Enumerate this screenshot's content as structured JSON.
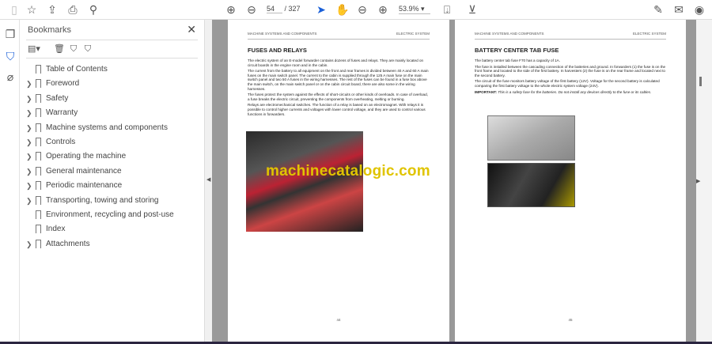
{
  "toolbar": {
    "page_current": "54",
    "page_total": "/ 327",
    "zoom": "53.9%"
  },
  "bookmarks": {
    "title": "Bookmarks",
    "items": [
      {
        "label": "Table of Contents",
        "expandable": false
      },
      {
        "label": "Foreword",
        "expandable": true
      },
      {
        "label": "Safety",
        "expandable": true
      },
      {
        "label": "Warranty",
        "expandable": true
      },
      {
        "label": "Machine systems and components",
        "expandable": true
      },
      {
        "label": "Controls",
        "expandable": true
      },
      {
        "label": "Operating the machine",
        "expandable": true
      },
      {
        "label": "General maintenance",
        "expandable": true
      },
      {
        "label": "Periodic maintenance",
        "expandable": true
      },
      {
        "label": "Transporting, towing and storing",
        "expandable": true
      },
      {
        "label": "Environment, recycling and post-use",
        "expandable": false
      },
      {
        "label": "Index",
        "expandable": false
      },
      {
        "label": "Attachments",
        "expandable": true
      }
    ]
  },
  "page1": {
    "header_left": "MACHINE SYSTEMS AND COMPONENTS",
    "header_right": "ELECTRIC SYSTEM",
    "title": "FUSES AND RELAYS",
    "paragraphs": [
      "The electric system of an E-model forwarder contains dozens of fuses and relays. They are mainly located on circuit boards in the engine room and in the cabin.",
      "The current from the battery to all equipment on the front and rear frames is divided between 40 A and 60 A main fuses on the main switch panel. The current to the cabin is supplied through the 125 A main fuse on the main switch panel and two 50 A fuses in the wiring harnesses. The rest of the fuses can be found in a fuse box above the main switch, on the main switch panel or on the cabin circuit board, there are also some in the wiring harnesses.",
      "The fuses protect the system against the effects of short-circuits or other kinds of overloads. In case of overload, a fuse breaks the electric circuit, preventing the components from overheating, melting or burning.",
      "Relays are electromechanical switches. The function of a relay is based on an electromagnet. With relays it is possible to control higher currents and voltages with lower control voltage, and they are used to control various functions in forwarders."
    ],
    "page_number": "44"
  },
  "page2": {
    "header_left": "MACHINE SYSTEMS AND COMPONENTS",
    "header_right": "ELECTRIC SYSTEM",
    "title": "BATTERY CENTER TAB FUSE",
    "paragraphs": [
      "The battery center tab fuse F70 has a capacity of 1A.",
      "The fuse is installed between the cascading connection of the batteries and ground. In forwarders (1) the fuse is on the front frame and located to the side of the first battery. In harvesters (2) the fuse is on the rear frame and located next to the second battery.",
      "The circuit of the fuse monitors battery voltage of the first battery (12V). Voltage for the second battery is calculated comparing the first battery voltage to the whole electric system voltage (24V)."
    ],
    "important_label": "IMPORTANT:",
    "important_text": " This is a safety fuse for the batteries. Do not install any devices directly to the fuse or its cables.",
    "page_number": "45"
  },
  "watermark": "machinecatalogic.com"
}
